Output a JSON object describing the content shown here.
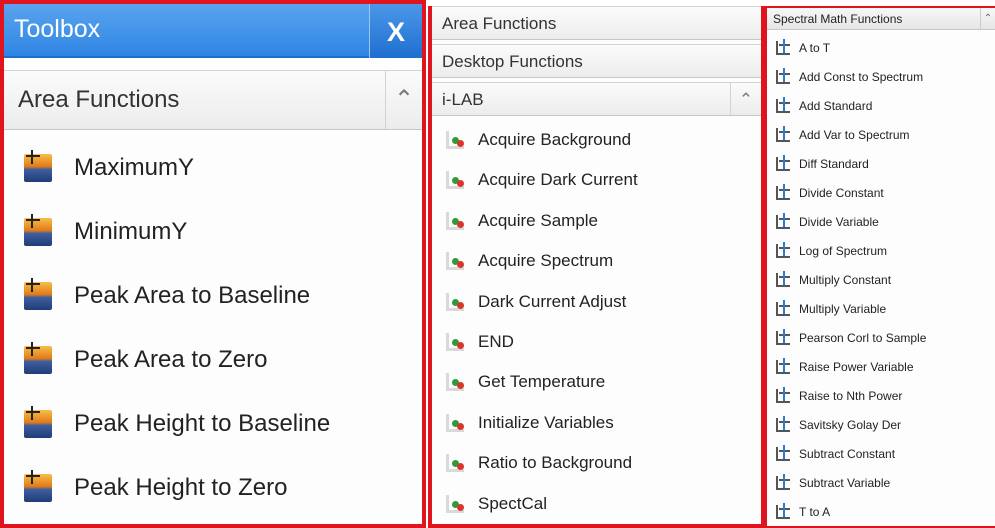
{
  "toolbox": {
    "title": "Toolbox",
    "close_label": "X",
    "section": "Area Functions",
    "items": [
      {
        "label": "MaximumY"
      },
      {
        "label": "MinimumY"
      },
      {
        "label": "Peak Area to Baseline"
      },
      {
        "label": "Peak Area to Zero"
      },
      {
        "label": "Peak Height to Baseline"
      },
      {
        "label": "Peak Height to Zero"
      }
    ]
  },
  "functions": {
    "sections": [
      "Area Functions",
      "Desktop Functions",
      "i-LAB"
    ],
    "items": [
      {
        "label": "Acquire Background"
      },
      {
        "label": "Acquire Dark Current"
      },
      {
        "label": "Acquire Sample"
      },
      {
        "label": "Acquire Spectrum"
      },
      {
        "label": "Dark Current Adjust"
      },
      {
        "label": "END"
      },
      {
        "label": "Get Temperature"
      },
      {
        "label": "Initialize Variables"
      },
      {
        "label": "Ratio to Background"
      },
      {
        "label": "SpectCal"
      }
    ]
  },
  "spectral": {
    "title": "Spectral Math Functions",
    "items": [
      {
        "label": "A to T"
      },
      {
        "label": "Add Const to Spectrum"
      },
      {
        "label": "Add Standard"
      },
      {
        "label": "Add Var to Spectrum"
      },
      {
        "label": "Diff Standard"
      },
      {
        "label": "Divide Constant"
      },
      {
        "label": "Divide Variable"
      },
      {
        "label": "Log of Spectrum"
      },
      {
        "label": "Multiply Constant"
      },
      {
        "label": "Multiply Variable"
      },
      {
        "label": "Pearson Corl to Sample"
      },
      {
        "label": "Raise Power Variable"
      },
      {
        "label": "Raise to Nth Power"
      },
      {
        "label": "Savitsky Golay Der"
      },
      {
        "label": "Subtract Constant"
      },
      {
        "label": "Subtract Variable"
      },
      {
        "label": "T to A"
      }
    ]
  },
  "icons": {
    "collapse": "chevron-up-icon",
    "toolbox_item": "peak-function-icon",
    "ilab_item": "ilab-function-icon",
    "spectral_item": "spectral-math-icon"
  },
  "colors": {
    "highlight_border": "#e0141e",
    "title_bar": "#2f86e4"
  }
}
